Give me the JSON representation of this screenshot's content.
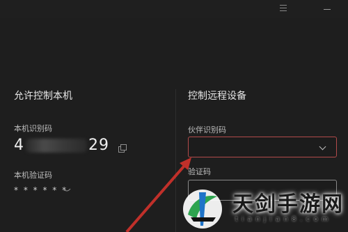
{
  "titlebar": {
    "menu_icon": "menu-icon",
    "minimize_icon": "minimize-icon"
  },
  "left": {
    "title": "允许控制本机",
    "id_label": "本机识别码",
    "id_prefix": "4",
    "id_suffix": "29",
    "password_label": "本机验证码",
    "password_value": "* * * * * *"
  },
  "right": {
    "title": "控制远程设备",
    "partner_label": "伙伴识别码",
    "partner_value": "",
    "verify_label": "验证码"
  },
  "watermark": {
    "text": "天剑手游网",
    "url": "tianjian8.com"
  },
  "colors": {
    "background": "#1e1e1e",
    "active_border": "#b34b4b",
    "arrow": "#c0302a"
  }
}
